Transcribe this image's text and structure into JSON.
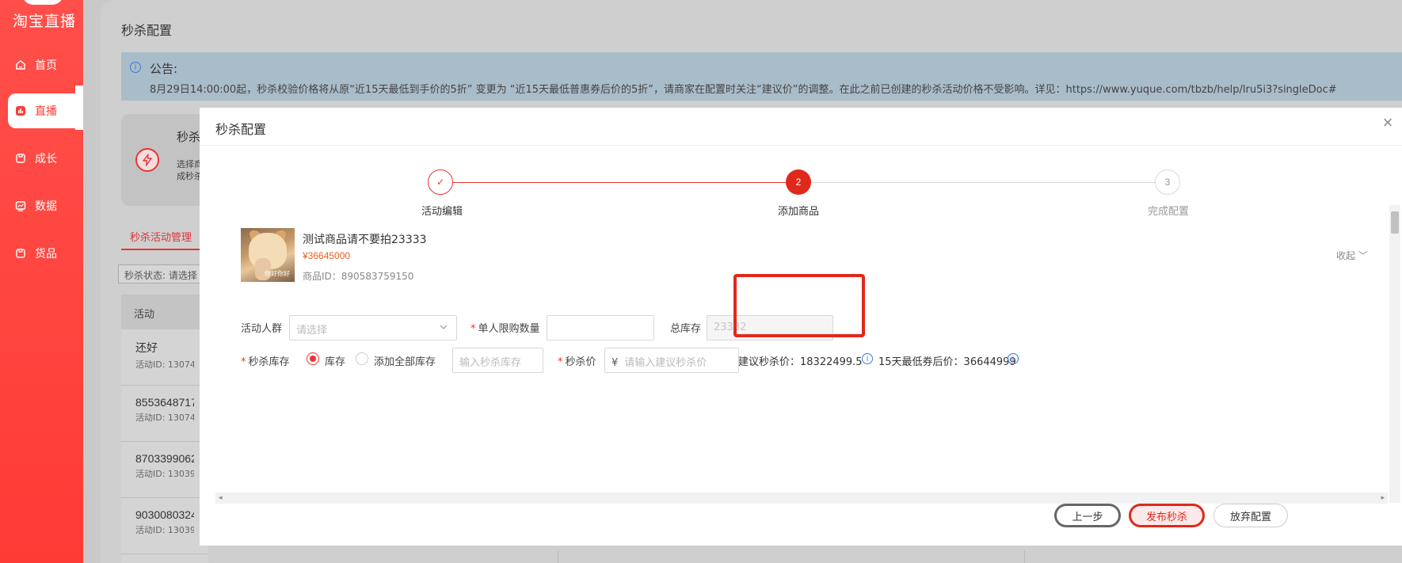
{
  "brand": {
    "logo_text": "淘宝直播"
  },
  "sidebar": {
    "items": [
      {
        "label": "首页",
        "icon": "home-icon"
      },
      {
        "label": "直播",
        "icon": "live-icon"
      },
      {
        "label": "成长",
        "icon": "growth-icon"
      },
      {
        "label": "数据",
        "icon": "chart-icon"
      },
      {
        "label": "货品",
        "icon": "goods-icon"
      }
    ],
    "active_index": 1
  },
  "page": {
    "title": "秒杀配置"
  },
  "notice": {
    "title": "公告:",
    "text": "8月29日14:00:00起，秒杀校验价格将从原“近15天最低到手价的5折” 变更为 “近15天最低普惠券后价的5折”，请商家在配置时关注“建议价”的调整。在此之前已创建的秒杀活动价格不受影响。详见：https://www.yuque.com/tbzb/help/lru5i3?singleDoc#"
  },
  "background": {
    "card": {
      "title": "秒杀",
      "desc_line1": "选择商",
      "desc_line2": "成秒杀"
    },
    "tab": "秒杀活动管理",
    "filter": "秒杀状态:  请选择",
    "table_header": "活动",
    "rows": [
      {
        "name": "还好",
        "id": "活动ID: 13074"
      },
      {
        "name": "8553648717",
        "id": "活动ID: 13074"
      },
      {
        "name": "8703399062",
        "id": "活动ID: 13039"
      },
      {
        "name": "9030080324",
        "id": "活动ID: 13039"
      }
    ]
  },
  "modal": {
    "title": "秒杀配置",
    "close": "×",
    "steps": [
      {
        "label": "活动编辑",
        "status": "done",
        "mark": "✓"
      },
      {
        "label": "添加商品",
        "status": "current",
        "mark": "2"
      },
      {
        "label": "完成配置",
        "status": "pending",
        "mark": "3"
      }
    ],
    "product": {
      "name": "测试商品请不要拍23333",
      "price": "¥36645000",
      "id": "商品ID：890583759150",
      "image_caption": "你好你好"
    },
    "collapse_label": "收起 ﹀",
    "form": {
      "audience_label": "活动人群",
      "audience_placeholder": "请选择",
      "limit_label": "单人限购数量",
      "limit_value": "",
      "total_stock_label": "总库存",
      "total_stock_value": "23332",
      "seckill_stock_label": "秒杀库存",
      "radio_stock": "库存",
      "radio_all_stock": "添加全部库存",
      "stock_input_placeholder": "输入秒杀库存",
      "seckill_price_label": "秒杀价",
      "currency": "¥",
      "price_placeholder": "请输入建议秒杀价",
      "suggest_price": "建议秒杀价：18322499.5",
      "lowest_price": "15天最低券后价：36644999"
    },
    "buttons": {
      "prev": "上一步",
      "publish": "发布秒杀",
      "abandon": "放弃配置"
    }
  },
  "colors": {
    "brand_red": "#ff3b36",
    "accent_red": "#e0291b",
    "price_orange": "#f05a1a",
    "info_blue": "#3b7bd6"
  }
}
